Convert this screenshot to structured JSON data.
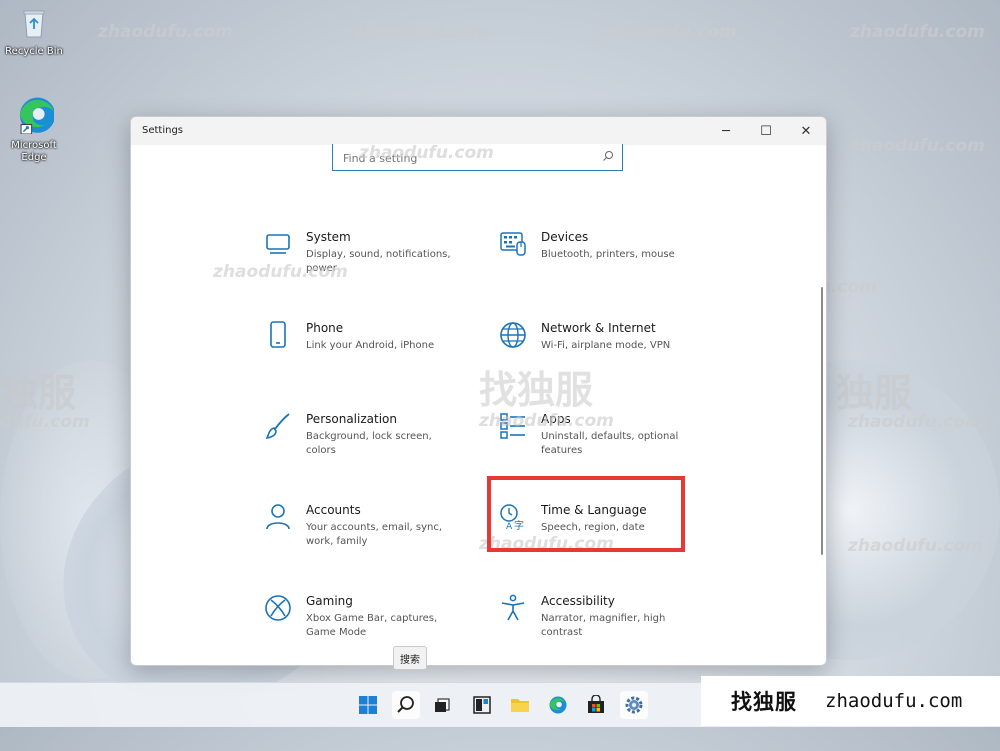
{
  "desktop": {
    "icons": [
      {
        "name": "recycle-bin-icon",
        "label": "Recycle Bin"
      },
      {
        "name": "edge-icon",
        "label": "Microsoft Edge"
      }
    ]
  },
  "window": {
    "title": "Settings",
    "controls": {
      "minimize": "─",
      "maximize": "☐",
      "close": "✕"
    },
    "search": {
      "placeholder": "Find a setting"
    }
  },
  "categories": [
    {
      "key": "system",
      "name": "System",
      "desc": "Display, sound, notifications, power",
      "icon": "monitor-icon"
    },
    {
      "key": "devices",
      "name": "Devices",
      "desc": "Bluetooth, printers, mouse",
      "icon": "keyboard-icon"
    },
    {
      "key": "phone",
      "name": "Phone",
      "desc": "Link your Android, iPhone",
      "icon": "phone-icon"
    },
    {
      "key": "network",
      "name": "Network & Internet",
      "desc": "Wi-Fi, airplane mode, VPN",
      "icon": "globe-icon"
    },
    {
      "key": "personalization",
      "name": "Personalization",
      "desc": "Background, lock screen, colors",
      "icon": "brush-icon"
    },
    {
      "key": "apps",
      "name": "Apps",
      "desc": "Uninstall, defaults, optional features",
      "icon": "apps-list-icon"
    },
    {
      "key": "accounts",
      "name": "Accounts",
      "desc": "Your accounts, email, sync, work, family",
      "icon": "person-icon"
    },
    {
      "key": "time",
      "name": "Time & Language",
      "desc": "Speech, region, date",
      "icon": "time-language-icon"
    },
    {
      "key": "gaming",
      "name": "Gaming",
      "desc": "Xbox Game Bar, captures, Game Mode",
      "icon": "xbox-icon"
    },
    {
      "key": "accessibility",
      "name": "Accessibility",
      "desc": "Narrator, magnifier, high contrast",
      "icon": "accessibility-icon"
    }
  ],
  "tooltip": {
    "text": "搜索"
  },
  "taskbar": {
    "items": [
      "start-icon",
      "search-icon",
      "task-view-icon",
      "widgets-icon",
      "file-explorer-icon",
      "edge-icon",
      "store-icon",
      "settings-icon"
    ]
  },
  "watermark": {
    "cn": "找独服",
    "url": "zhaodufu.com",
    "partial_cn": "独服",
    "partial_url": "dufu.com"
  },
  "brand": {
    "cn": "找独服",
    "url": "zhaodufu.com"
  },
  "colors": {
    "accent": "#1a73b8",
    "highlight": "#e53935"
  }
}
